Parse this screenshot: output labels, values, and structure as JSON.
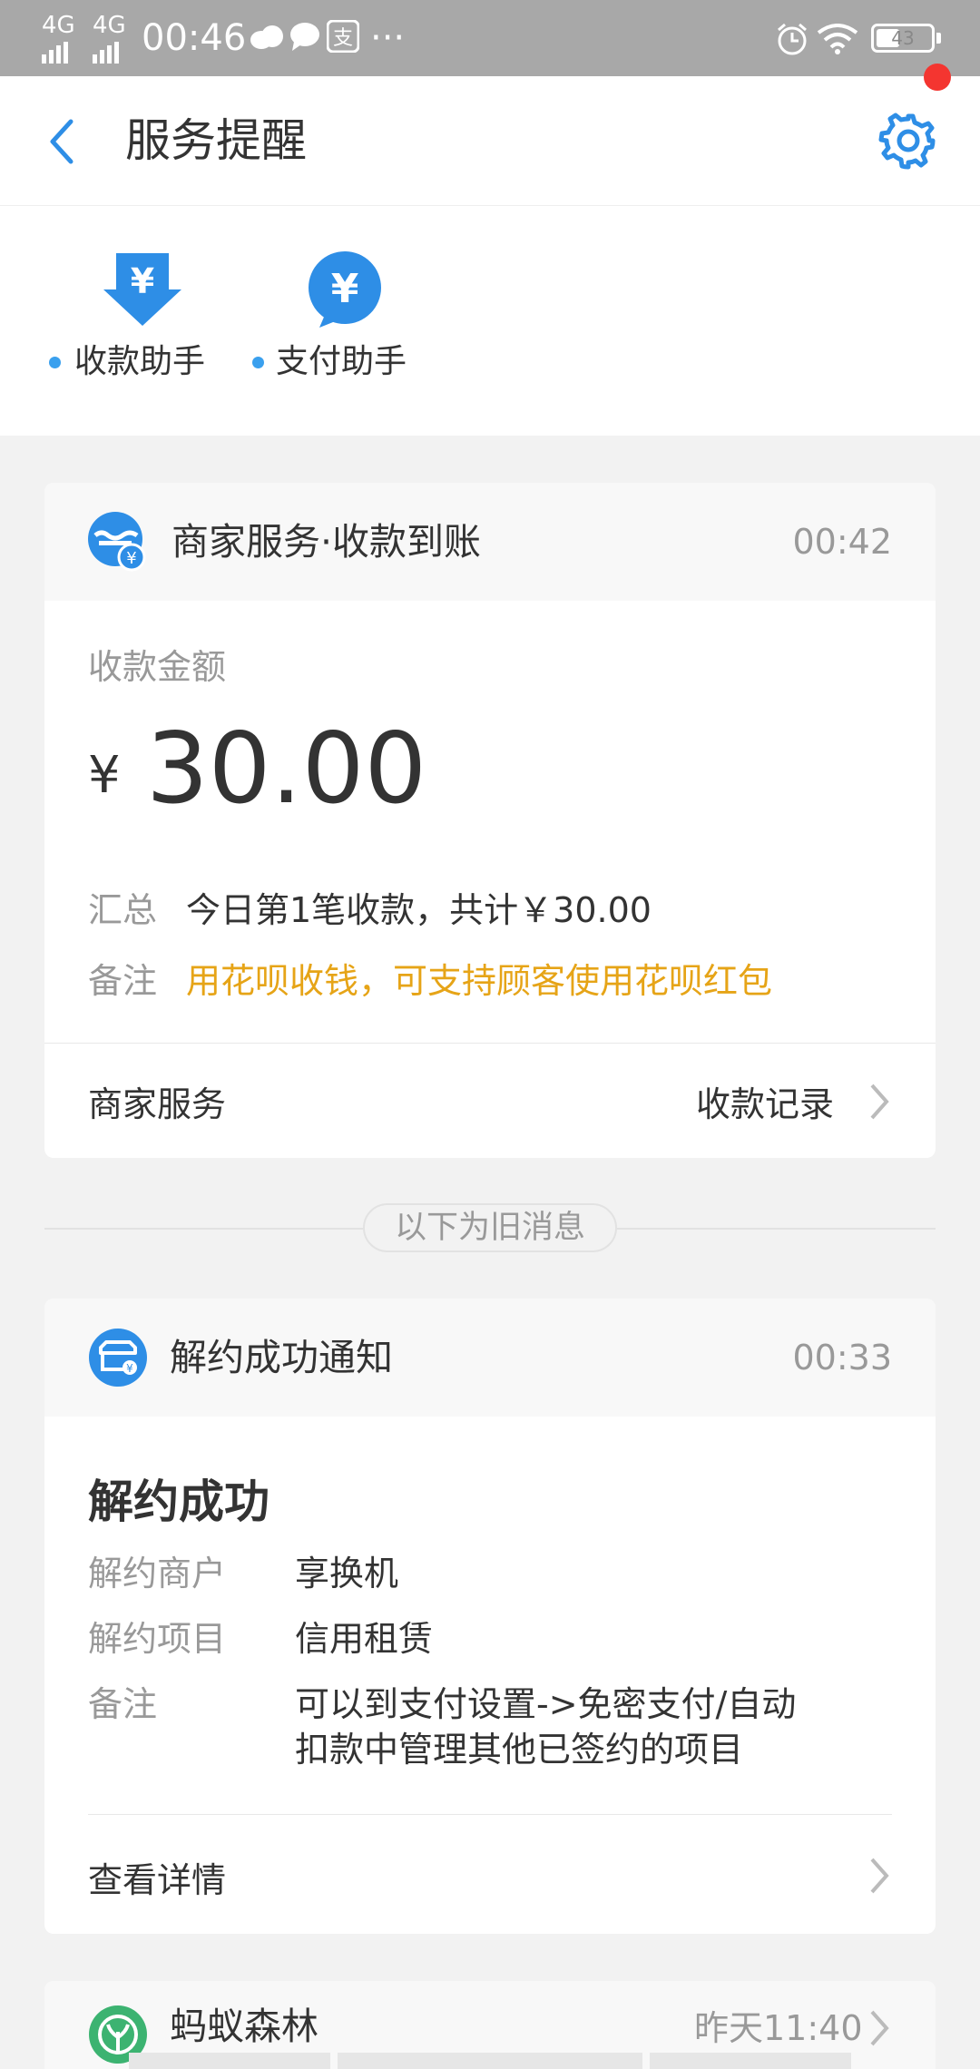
{
  "status_bar": {
    "signal_1": "4G",
    "signal_2": "4G",
    "time": "00:46",
    "more": "···",
    "battery": "43",
    "icons": [
      "cloud-icon",
      "chat-bubble-icon",
      "alipay-icon",
      "alarm-icon",
      "wifi-icon",
      "battery-icon"
    ]
  },
  "header": {
    "title": "服务提醒",
    "back_icon": "back-arrow-icon",
    "settings_icon": "gear-icon",
    "has_notification_dot": true
  },
  "assistants": [
    {
      "label": "收款助手",
      "icon": "download-yen-icon"
    },
    {
      "label": "支付助手",
      "icon": "yen-bubble-icon"
    }
  ],
  "payment_card": {
    "source": "商家服务·收款到账",
    "time": "00:42",
    "amount_label": "收款金额",
    "currency": "¥",
    "amount": "30.00",
    "summary_label": "汇总",
    "summary_value": "今日第1笔收款，共计￥30.00",
    "note_label": "备注",
    "note_value": "用花呗收钱，可支持顾客使用花呗红包",
    "footer_left": "商家服务",
    "footer_right": "收款记录",
    "colors": {
      "note": "#e6a417",
      "icon": "#2e8ee6"
    }
  },
  "old_messages_divider": "以下为旧消息",
  "cancel_card": {
    "source": "解约成功通知",
    "time": "00:33",
    "title": "解约成功",
    "rows": [
      {
        "label": "解约商户",
        "value": "享换机"
      },
      {
        "label": "解约项目",
        "value": "信用租赁"
      },
      {
        "label": "备注",
        "value_line1": "可以到支付设置->免密支付/自动",
        "value_line2": "扣款中管理其他已签约的项目"
      }
    ],
    "footer": "查看详情"
  },
  "forest_card": {
    "source": "蚂蚁森林",
    "time": "昨天11:40"
  }
}
